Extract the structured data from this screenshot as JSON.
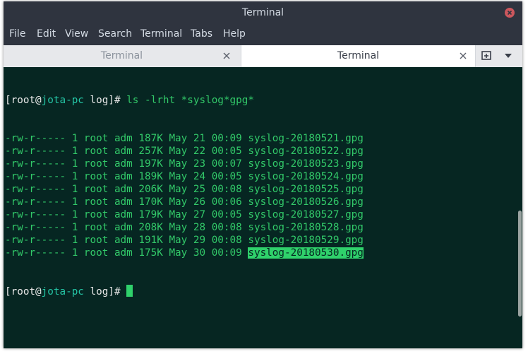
{
  "window": {
    "title": "Terminal"
  },
  "menu": [
    "File",
    "Edit",
    "View",
    "Search",
    "Terminal",
    "Tabs",
    "Help"
  ],
  "tabs": [
    {
      "label": "Terminal",
      "active": false
    },
    {
      "label": "Terminal",
      "active": true
    }
  ],
  "terminal": {
    "prompt": {
      "open": "[",
      "user": "root",
      "at": "@",
      "host": "jota-pc",
      "dir": " log]# "
    },
    "command": "ls -lrht *syslog*gpg*",
    "listing": [
      {
        "perms": "-rw-r-----",
        "links": "1",
        "owner": "root",
        "group": "adm",
        "size": "187K",
        "month": "May",
        "day": "21",
        "time": "00:09",
        "name": "syslog-20180521.gpg"
      },
      {
        "perms": "-rw-r-----",
        "links": "1",
        "owner": "root",
        "group": "adm",
        "size": "257K",
        "month": "May",
        "day": "22",
        "time": "00:05",
        "name": "syslog-20180522.gpg"
      },
      {
        "perms": "-rw-r-----",
        "links": "1",
        "owner": "root",
        "group": "adm",
        "size": "197K",
        "month": "May",
        "day": "23",
        "time": "00:07",
        "name": "syslog-20180523.gpg"
      },
      {
        "perms": "-rw-r-----",
        "links": "1",
        "owner": "root",
        "group": "adm",
        "size": "189K",
        "month": "May",
        "day": "24",
        "time": "00:05",
        "name": "syslog-20180524.gpg"
      },
      {
        "perms": "-rw-r-----",
        "links": "1",
        "owner": "root",
        "group": "adm",
        "size": "206K",
        "month": "May",
        "day": "25",
        "time": "00:08",
        "name": "syslog-20180525.gpg"
      },
      {
        "perms": "-rw-r-----",
        "links": "1",
        "owner": "root",
        "group": "adm",
        "size": "170K",
        "month": "May",
        "day": "26",
        "time": "00:06",
        "name": "syslog-20180526.gpg"
      },
      {
        "perms": "-rw-r-----",
        "links": "1",
        "owner": "root",
        "group": "adm",
        "size": "179K",
        "month": "May",
        "day": "27",
        "time": "00:05",
        "name": "syslog-20180527.gpg"
      },
      {
        "perms": "-rw-r-----",
        "links": "1",
        "owner": "root",
        "group": "adm",
        "size": "208K",
        "month": "May",
        "day": "28",
        "time": "00:08",
        "name": "syslog-20180528.gpg"
      },
      {
        "perms": "-rw-r-----",
        "links": "1",
        "owner": "root",
        "group": "adm",
        "size": "191K",
        "month": "May",
        "day": "29",
        "time": "00:08",
        "name": "syslog-20180529.gpg"
      },
      {
        "perms": "-rw-r-----",
        "links": "1",
        "owner": "root",
        "group": "adm",
        "size": "175K",
        "month": "May",
        "day": "30",
        "time": "00:09",
        "name": "syslog-20180530.gpg",
        "selected": true
      }
    ]
  },
  "colors": {
    "terminal_bg": "#062622",
    "terminal_fg": "#32c969",
    "prompt_user": "#e8e8e8",
    "prompt_host": "#25c6a6",
    "selection_bg": "#2fd16b",
    "titlebar_bg": "#2f343f",
    "close_button": "#cc575d"
  },
  "icons": {
    "window_close": "close-icon",
    "tab_close": "close-icon",
    "new_tab": "new-tab-icon",
    "tab_menu": "chevron-down-icon"
  }
}
